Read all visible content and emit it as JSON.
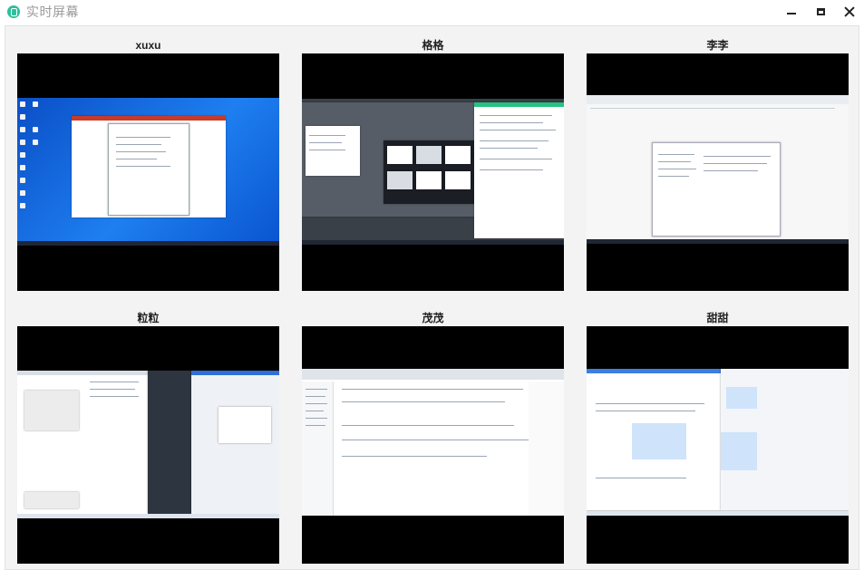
{
  "window": {
    "title": "实时屏幕",
    "controls": [
      "minimize",
      "maximize",
      "close"
    ]
  },
  "tiles": [
    {
      "name": "xuxu"
    },
    {
      "name": "格格"
    },
    {
      "name": "李李"
    },
    {
      "name": "粒粒"
    },
    {
      "name": "茂茂"
    },
    {
      "name": "甜甜"
    }
  ],
  "colors": {
    "screen_bg": "#000000",
    "panel_bg": "#f3f3f3",
    "app_icon": "#2fbf9b"
  }
}
